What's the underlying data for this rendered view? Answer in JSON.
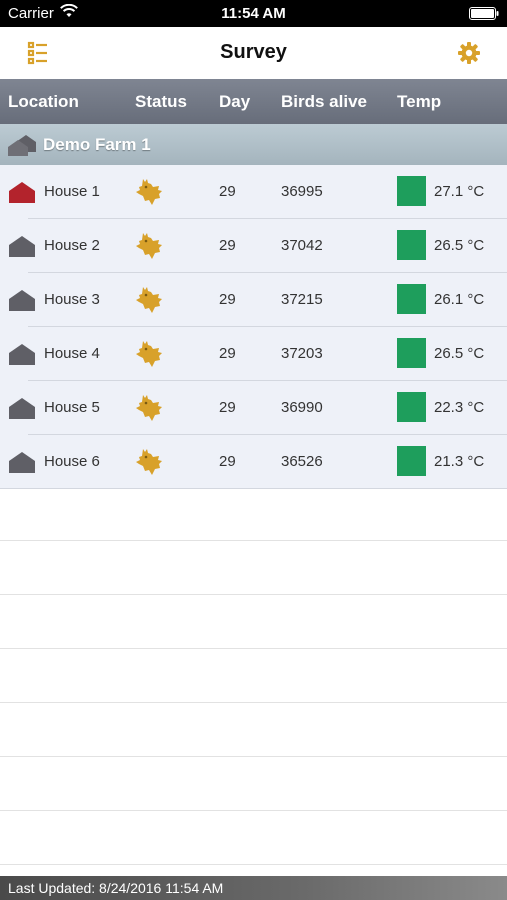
{
  "status_bar": {
    "carrier": "Carrier",
    "time": "11:54 AM"
  },
  "nav": {
    "title": "Survey",
    "left_icon": "list-icon",
    "right_icon": "gear-icon"
  },
  "columns": {
    "location": "Location",
    "status": "Status",
    "day": "Day",
    "birds": "Birds alive",
    "temp": "Temp"
  },
  "farm": {
    "name": "Demo Farm 1"
  },
  "houses": [
    {
      "name": "House 1",
      "day": "29",
      "birds": "36995",
      "temp": "27.1 °C",
      "alert": true
    },
    {
      "name": "House 2",
      "day": "29",
      "birds": "37042",
      "temp": "26.5 °C",
      "alert": false
    },
    {
      "name": "House 3",
      "day": "29",
      "birds": "37215",
      "temp": "26.1 °C",
      "alert": false
    },
    {
      "name": "House 4",
      "day": "29",
      "birds": "37203",
      "temp": "26.5 °C",
      "alert": false
    },
    {
      "name": "House 5",
      "day": "29",
      "birds": "36990",
      "temp": "22.3 °C",
      "alert": false
    },
    {
      "name": "House 6",
      "day": "29",
      "birds": "36526",
      "temp": "21.3 °C",
      "alert": false
    }
  ],
  "footer": {
    "last_updated": "Last Updated: 8/24/2016 11:54 AM"
  },
  "colors": {
    "accent": "#d8a12a",
    "temp_ok": "#1e9e5c",
    "house_alert": "#b3232c",
    "house_normal": "#5f5f66"
  }
}
